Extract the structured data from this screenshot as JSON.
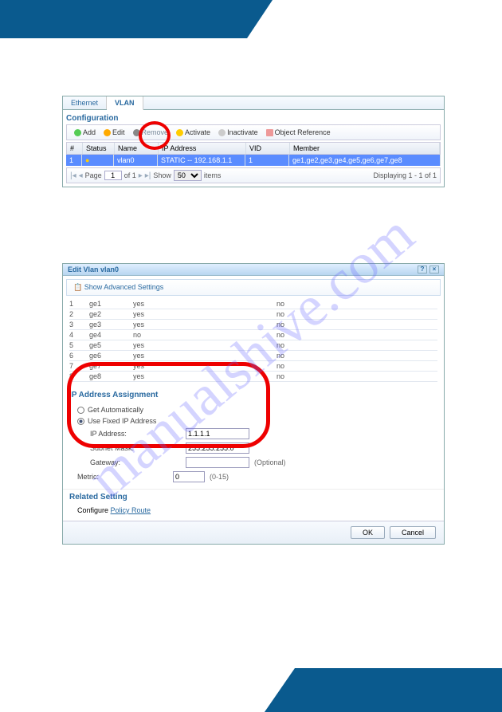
{
  "watermark": "manualshive.com",
  "panel1": {
    "tabs": {
      "ethernet": "Ethernet",
      "vlan": "VLAN"
    },
    "config": "Configuration",
    "toolbar": {
      "add": "Add",
      "edit": "Edit",
      "remove": "Remove",
      "activate": "Activate",
      "inactivate": "Inactivate",
      "obj": "Object Reference"
    },
    "cols": {
      "num": "#",
      "status": "Status",
      "name": "Name",
      "ip": "IP Address",
      "vid": "VID",
      "member": "Member"
    },
    "row": {
      "num": "1",
      "status": "●",
      "name": "vlan0",
      "ip": "STATIC -- 192.168.1.1",
      "vid": "1",
      "member": "ge1,ge2,ge3,ge4,ge5,ge6,ge7,ge8"
    },
    "pager": {
      "page": "Page",
      "of": "of 1",
      "show": "Show",
      "items": "items",
      "disp": "Displaying 1 - 1 of 1",
      "pageval": "1",
      "showval": "50"
    }
  },
  "panel2": {
    "title": "Edit Vlan vlan0",
    "showadv": "Show Advanced Settings",
    "ge": [
      {
        "n": "1",
        "name": "ge1",
        "a": "yes",
        "b": "no"
      },
      {
        "n": "2",
        "name": "ge2",
        "a": "yes",
        "b": "no"
      },
      {
        "n": "3",
        "name": "ge3",
        "a": "yes",
        "b": "no"
      },
      {
        "n": "4",
        "name": "ge4",
        "a": "no",
        "b": "no"
      },
      {
        "n": "5",
        "name": "ge5",
        "a": "yes",
        "b": "no"
      },
      {
        "n": "6",
        "name": "ge6",
        "a": "yes",
        "b": "no"
      },
      {
        "n": "7",
        "name": "ge7",
        "a": "yes",
        "b": "no"
      },
      {
        "n": "8",
        "name": "ge8",
        "a": "yes",
        "b": "no"
      }
    ],
    "assign": {
      "title": "IP Address Assignment",
      "auto": "Get Automatically",
      "fixed": "Use Fixed IP Address",
      "ip_l": "IP Address:",
      "ip_v": "1.1.1.1",
      "mask_l": "Subnet Mask:",
      "mask_v": "255.255.255.0",
      "gw_l": "Gateway:",
      "gw_v": "",
      "opt": "(Optional)",
      "metric_l": "Metric:",
      "metric_v": "0",
      "range": "(0-15)"
    },
    "related": "Related Setting",
    "conf_pre": "Configure ",
    "conf_link": "Policy Route",
    "ok": "OK",
    "cancel": "Cancel"
  }
}
